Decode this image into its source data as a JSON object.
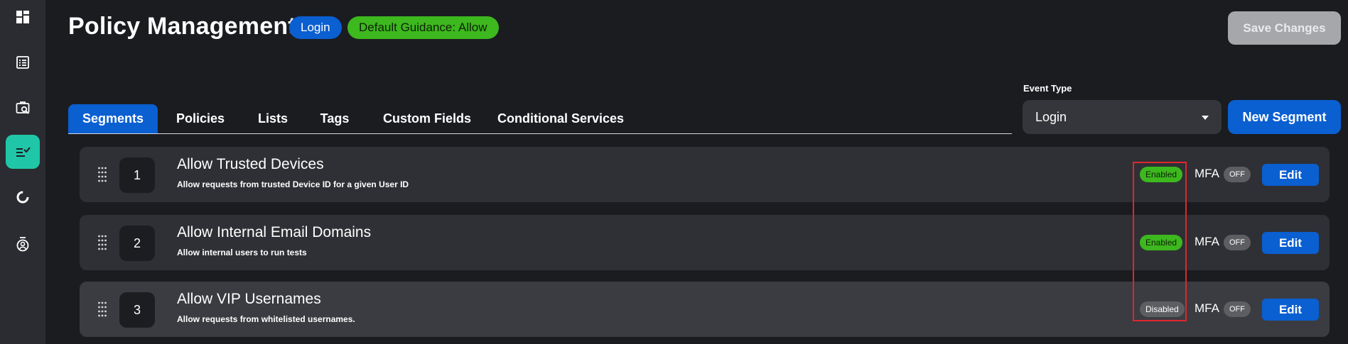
{
  "sidebar": {
    "items": [
      {
        "icon": "dashboard-icon",
        "active": false
      },
      {
        "icon": "list-icon",
        "active": false
      },
      {
        "icon": "briefcase-search-icon",
        "active": false
      },
      {
        "icon": "policy-checklist-icon",
        "active": true
      },
      {
        "icon": "donut-chart-icon",
        "active": false
      },
      {
        "icon": "user-badge-icon",
        "active": false
      }
    ]
  },
  "header": {
    "title": "Policy Management",
    "event_badge": "Login",
    "guidance_badge": "Default Guidance: Allow",
    "save_label": "Save Changes"
  },
  "tabs": [
    {
      "label": "Segments",
      "active": true
    },
    {
      "label": "Policies",
      "active": false
    },
    {
      "label": "Lists",
      "active": false
    },
    {
      "label": "Tags",
      "active": false
    },
    {
      "label": "Custom Fields",
      "active": false
    },
    {
      "label": "Conditional Services",
      "active": false
    }
  ],
  "event_type": {
    "label": "Event Type",
    "selected": "Login"
  },
  "new_segment_label": "New Segment",
  "segments": [
    {
      "number": "1",
      "title": "Allow Trusted Devices",
      "description": "Allow requests from trusted Device ID for a given User ID",
      "status": "Enabled",
      "mfa_label": "MFA",
      "mfa_state": "OFF",
      "edit_label": "Edit"
    },
    {
      "number": "2",
      "title": "Allow Internal Email Domains",
      "description": "Allow internal users to run tests",
      "status": "Enabled",
      "mfa_label": "MFA",
      "mfa_state": "OFF",
      "edit_label": "Edit"
    },
    {
      "number": "3",
      "title": "Allow VIP Usernames",
      "description": "Allow requests from whitelisted usernames.",
      "status": "Disabled",
      "mfa_label": "MFA",
      "mfa_state": "OFF",
      "edit_label": "Edit"
    }
  ],
  "colors": {
    "background": "#1b1c20",
    "sidebar": "#2b2c31",
    "accent_teal": "#1fc7a8",
    "primary_blue": "#0a5fd1",
    "enabled_green": "#3db81e",
    "disabled_gray": "#5d5e62",
    "highlight_red": "#e0262c"
  }
}
